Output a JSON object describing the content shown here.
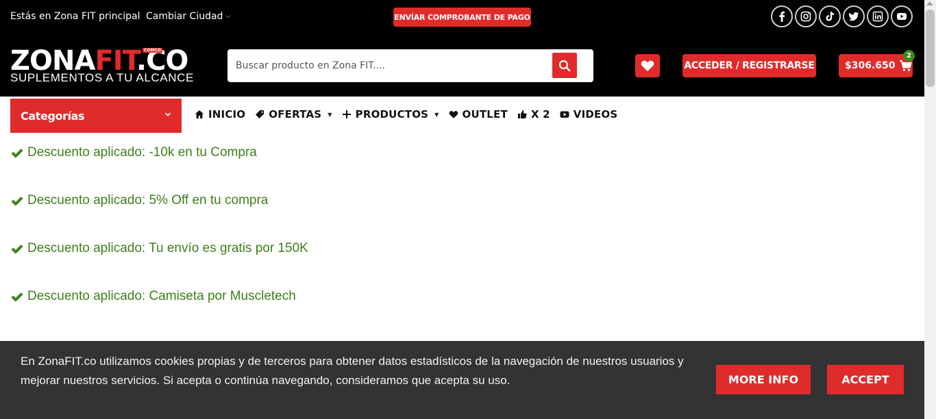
{
  "topbar": {
    "location_text": "Estás en Zona FIT principal",
    "city_switch_label": "Cambiar Ciudad",
    "payment_button_label": "ENVÍAR COMPROBANTE DE PAGO",
    "socials": [
      {
        "icon": "facebook-icon"
      },
      {
        "icon": "instagram-icon"
      },
      {
        "icon": "tiktok-icon"
      },
      {
        "icon": "twitter-icon"
      },
      {
        "icon": "linkedin-icon"
      },
      {
        "icon": "youtube-icon"
      }
    ]
  },
  "header": {
    "logo": {
      "part1": "ZONA",
      "part2": "FIT",
      "part3": ".CO",
      "badge": "COMCO",
      "tagline": "SUPLEMENTOS A TU ALCANCE"
    },
    "search": {
      "placeholder": "Buscar producto en Zona FIT...."
    },
    "login_label": "ACCEDER / REGISTRARSE",
    "cart": {
      "total": "$306.650",
      "count": "2"
    }
  },
  "nav": {
    "categories_label": "Categorías",
    "items": [
      {
        "label": "INICIO",
        "icon": "home-icon"
      },
      {
        "label": "OFERTAS",
        "icon": "tag-icon",
        "dropdown": true
      },
      {
        "label": "PRODUCTOS",
        "icon": "plus-icon",
        "dropdown": true
      },
      {
        "label": "OUTLET",
        "icon": "heart-icon"
      },
      {
        "label": "X 2",
        "icon": "thumbs-up-icon"
      },
      {
        "label": "VIDEOS",
        "icon": "video-icon"
      }
    ]
  },
  "discounts": [
    "Descuento aplicado: -10k en tu Compra",
    "Descuento aplicado: 5% Off en tu compra",
    "Descuento aplicado: Tu envío es gratis por 150K",
    "Descuento aplicado: Camiseta por Muscletech"
  ],
  "cookie_banner": {
    "text": "En ZonaFIT.co utilizamos cookies propias y de terceros para obtener datos estadísticos de la navegación de nuestros usuarios y mejorar nuestros servicios. Si acepta o continúa navegando, consideramos que acepta su uso.",
    "more_info_label": "MORE INFO",
    "accept_label": "ACCEPT"
  },
  "colors": {
    "accent": "#e02b2b",
    "success": "#3c7f1a",
    "dark": "#000000",
    "banner": "#333333"
  }
}
